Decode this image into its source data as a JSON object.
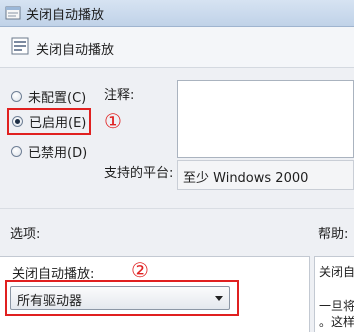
{
  "window": {
    "title": "关闭自动播放"
  },
  "header": {
    "title": "关闭自动播放"
  },
  "radios": [
    {
      "label": "未配置(C)",
      "checked": false
    },
    {
      "label": "已启用(E)",
      "checked": true
    },
    {
      "label": "已禁用(D)",
      "checked": false
    }
  ],
  "annotations": {
    "marker1": "①",
    "marker2": "②",
    "highlight_color": "#e02020"
  },
  "comment": {
    "label": "注释:"
  },
  "platform": {
    "label": "支持的平台:",
    "value": "至少 Windows 2000"
  },
  "options": {
    "section_label": "选项:",
    "field_label": "关闭自动播放:",
    "selected_value": "所有驱动器"
  },
  "help": {
    "section_label": "帮助:",
    "lines": [
      "关闭自",
      "一旦将",
      "。这样"
    ]
  }
}
